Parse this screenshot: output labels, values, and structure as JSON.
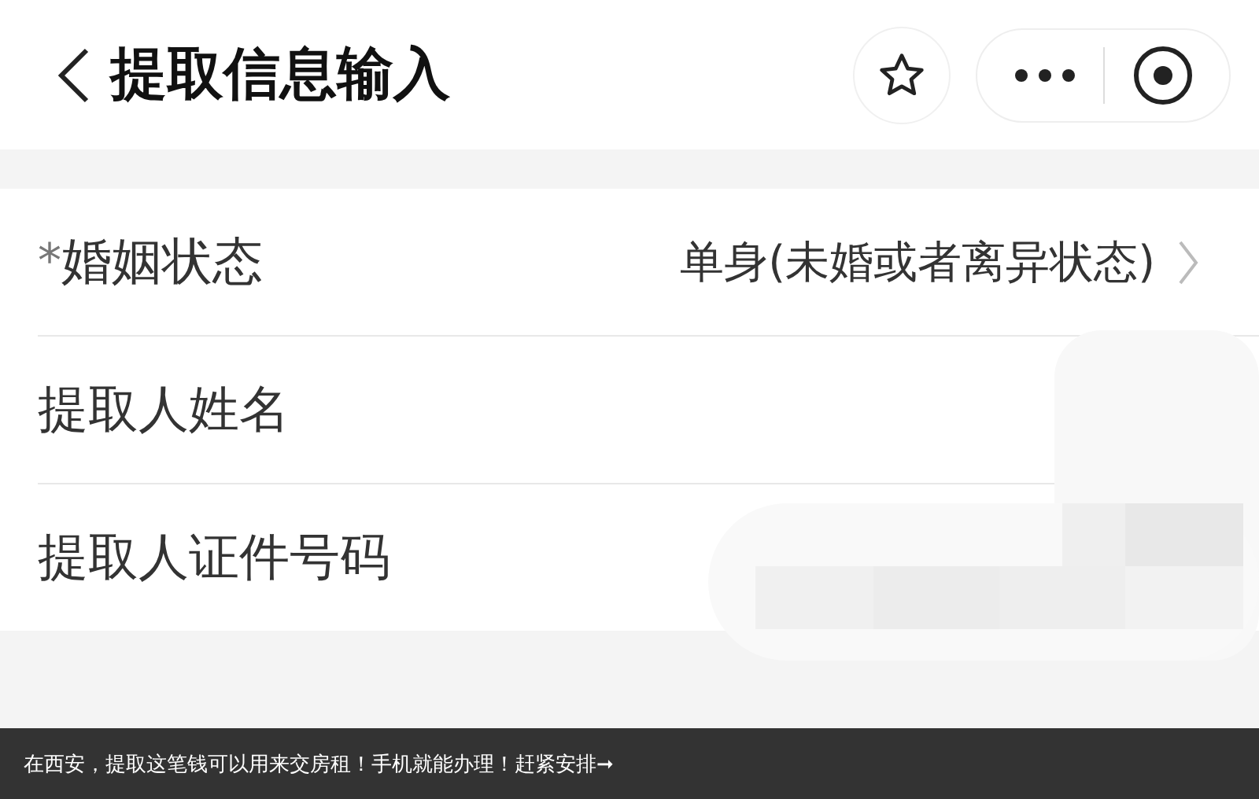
{
  "header": {
    "title": "提取信息输入"
  },
  "fields": [
    {
      "kind": "select",
      "required_mark": "*",
      "label": "婚姻状态",
      "value": "单身(未婚或者离异状态)"
    },
    {
      "kind": "text",
      "label": "提取人姓名"
    },
    {
      "kind": "text",
      "label": "提取人证件号码"
    }
  ],
  "caption": "在西安，提取这笔钱可以用来交房租！手机就能办理！赶紧安排➞"
}
